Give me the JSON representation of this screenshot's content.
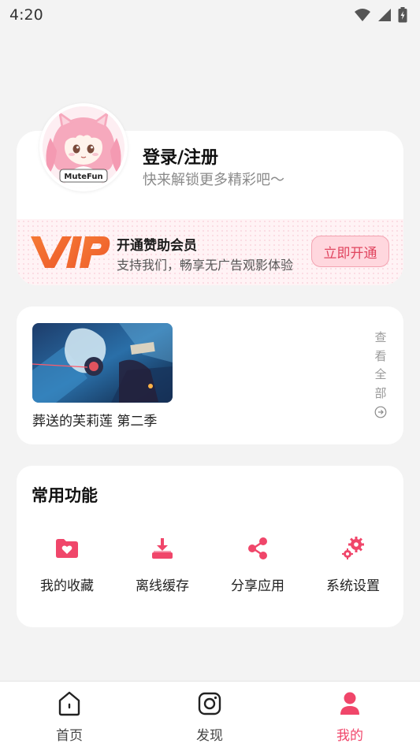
{
  "status_bar": {
    "time": "4:20"
  },
  "profile": {
    "login_title": "登录/注册",
    "login_subtitle": "快来解锁更多精彩吧～",
    "avatar_text": "MuteFun"
  },
  "vip": {
    "logo_text": "VIP",
    "title": "开通赞助会员",
    "subtitle": "支持我们，畅享无广告观影体验",
    "button_label": "立即开通"
  },
  "history": {
    "items": [
      {
        "title": "葬送的芙莉莲 第二季"
      }
    ],
    "view_all_chars": [
      "查",
      "看",
      "全",
      "部"
    ]
  },
  "functions": {
    "title": "常用功能",
    "items": [
      {
        "label": "我的收藏",
        "icon": "favorites-folder-icon"
      },
      {
        "label": "离线缓存",
        "icon": "download-icon"
      },
      {
        "label": "分享应用",
        "icon": "share-icon"
      },
      {
        "label": "系统设置",
        "icon": "settings-gears-icon"
      }
    ]
  },
  "nav": {
    "items": [
      {
        "label": "首页",
        "icon": "home-icon",
        "active": false
      },
      {
        "label": "发现",
        "icon": "discover-icon",
        "active": false
      },
      {
        "label": "我的",
        "icon": "profile-icon",
        "active": true
      }
    ]
  },
  "colors": {
    "accent": "#f0466a",
    "vip_orange": "#f26a2e",
    "background": "#f3f3f3"
  }
}
